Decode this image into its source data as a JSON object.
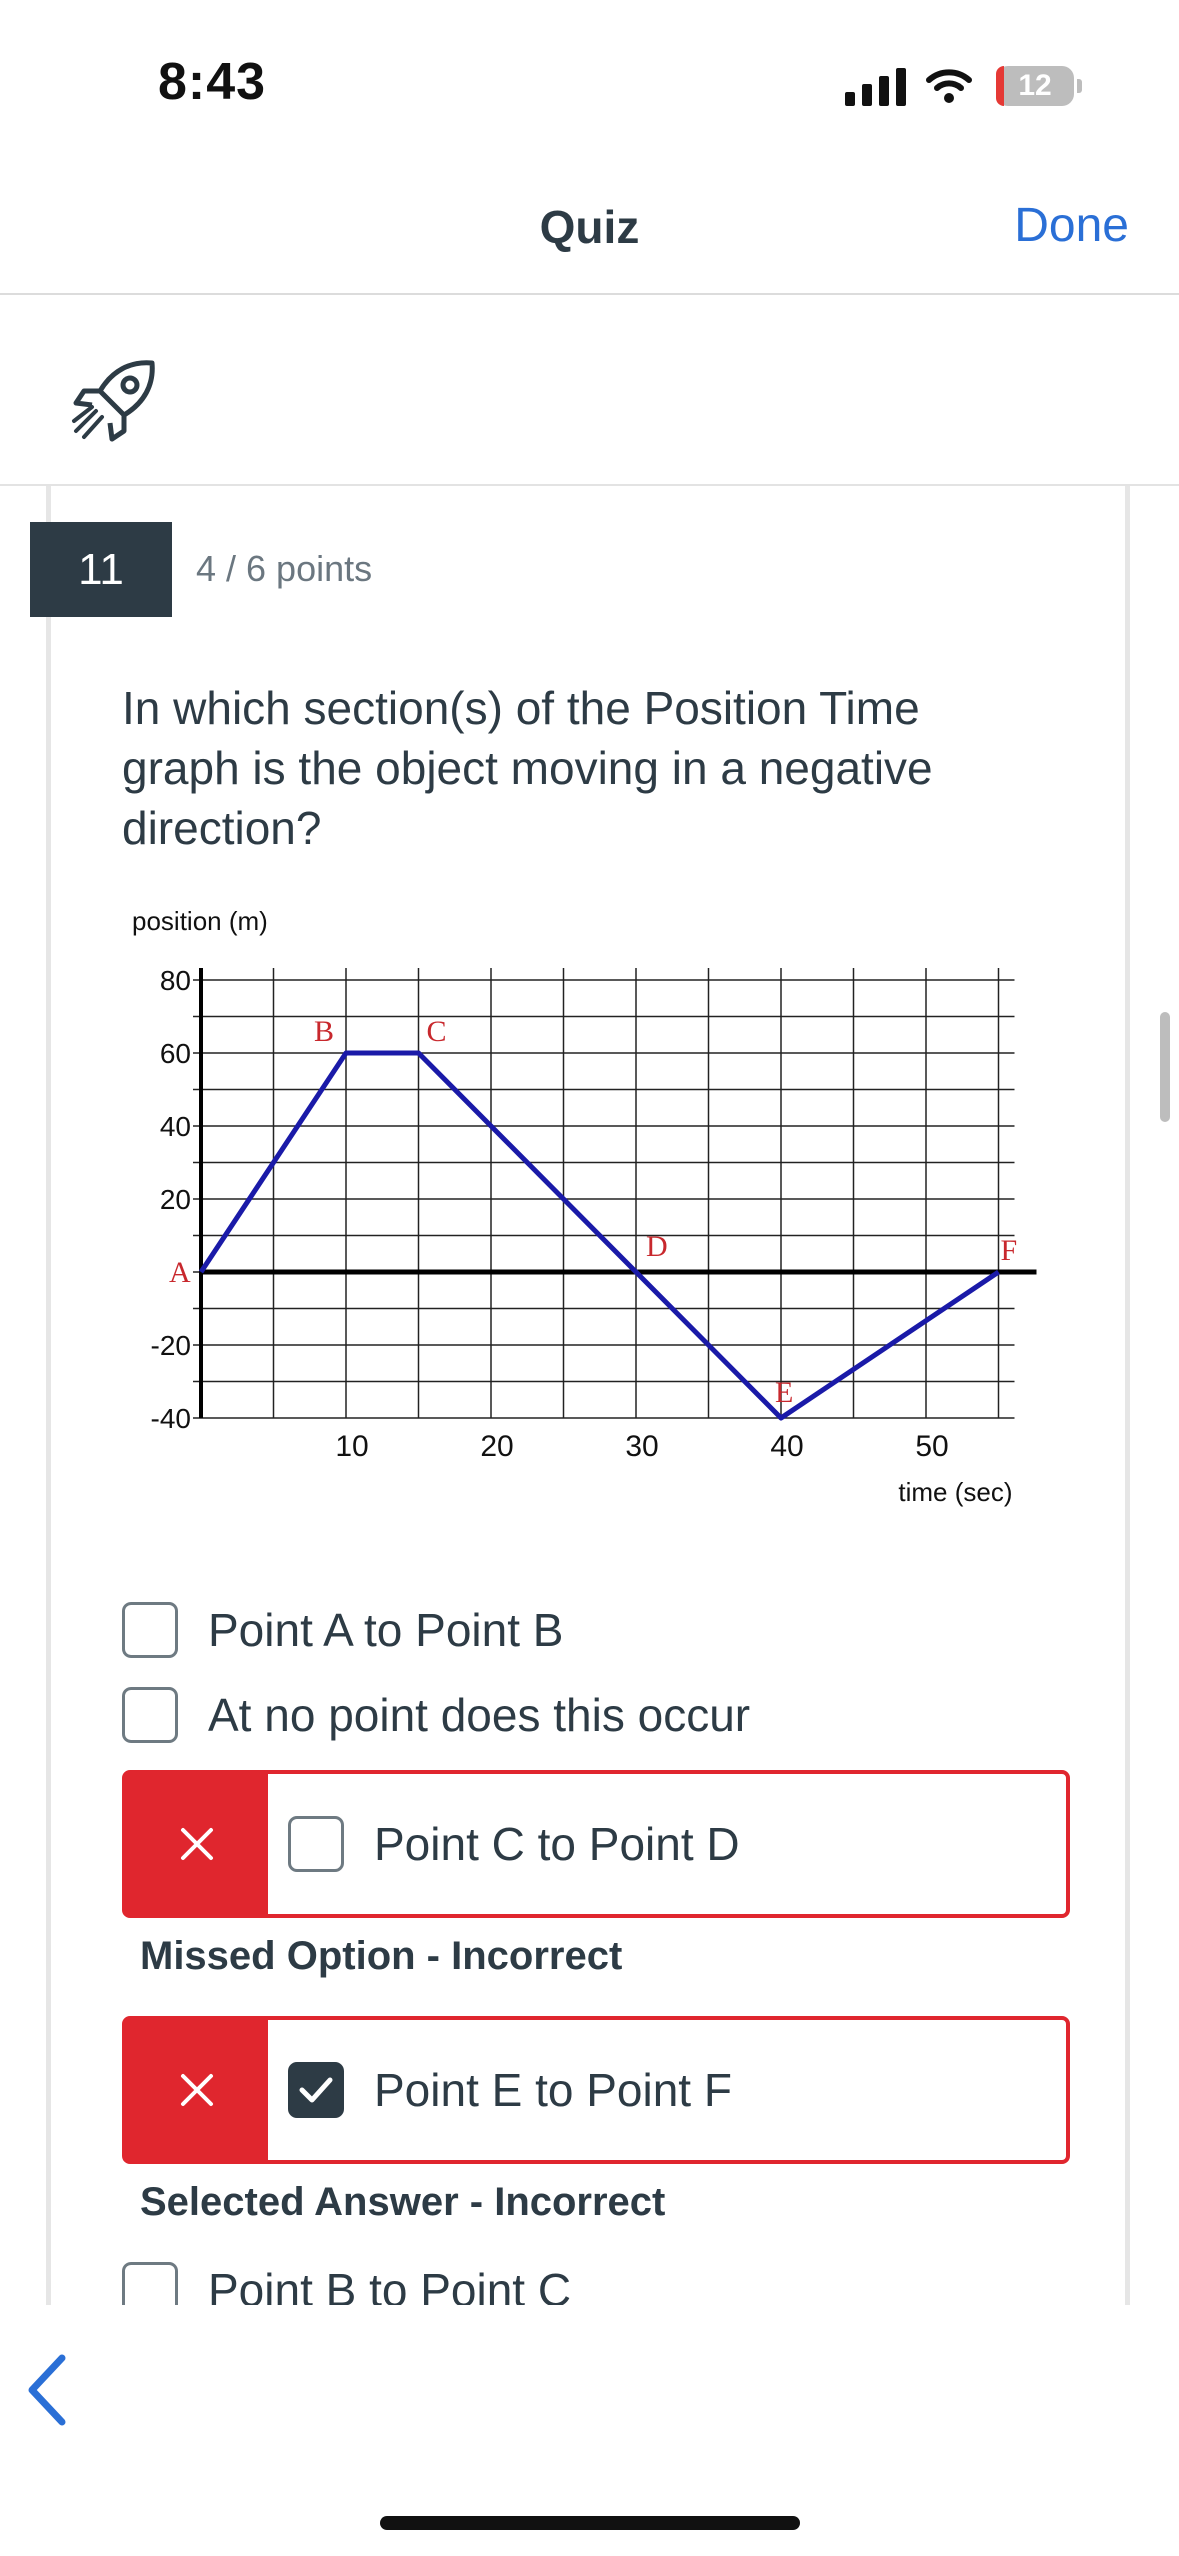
{
  "status_bar": {
    "time": "8:43",
    "battery": "12"
  },
  "nav": {
    "title": "Quiz",
    "done_label": "Done"
  },
  "question": {
    "number": "11",
    "points": "4 / 6 points",
    "text": "In which section(s) of the Position Time graph is the object moving in a negative direction?"
  },
  "chart_data": {
    "type": "line",
    "ylabel": "position (m)",
    "xlabel": "time (sec)",
    "xlim": [
      0,
      55
    ],
    "ylim": [
      -40,
      80
    ],
    "x_ticks": [
      "10",
      "20",
      "30",
      "40",
      "50"
    ],
    "y_ticks": [
      "80",
      "60",
      "40",
      "20",
      "-20",
      "-40"
    ],
    "series": [
      {
        "x": [
          0,
          10,
          15,
          30,
          40,
          55
        ],
        "y": [
          0,
          60,
          60,
          0,
          -40,
          0
        ]
      }
    ],
    "point_labels": [
      {
        "label": "A",
        "x": 0,
        "y": 0
      },
      {
        "label": "B",
        "x": 10,
        "y": 60
      },
      {
        "label": "C",
        "x": 15,
        "y": 60
      },
      {
        "label": "D",
        "x": 30,
        "y": 0
      },
      {
        "label": "E",
        "x": 40,
        "y": -40
      },
      {
        "label": "F",
        "x": 55,
        "y": 0
      }
    ],
    "line_color": "#1a1aa8",
    "label_color": "#c8282d",
    "grid": true
  },
  "answers": [
    {
      "label": "Point A to Point B",
      "checked": false
    },
    {
      "label": "At no point does this occur",
      "checked": false
    },
    {
      "label": "Point C to Point D",
      "checked": false,
      "status": "incorrect",
      "feedback": "Missed Option - Incorrect"
    },
    {
      "label": "Point E to Point F",
      "checked": true,
      "status": "incorrect",
      "feedback": "Selected Answer - Incorrect"
    },
    {
      "label": "Point B to Point C",
      "checked": false
    }
  ],
  "colors": {
    "accent": "#2a6fd6",
    "error": "#e0262e",
    "dark": "#2d3b45"
  },
  "icons": [
    "signal-icon",
    "wifi-icon",
    "battery-icon",
    "rocket-icon",
    "close-icon",
    "checkmark-icon",
    "back-chevron-icon"
  ]
}
